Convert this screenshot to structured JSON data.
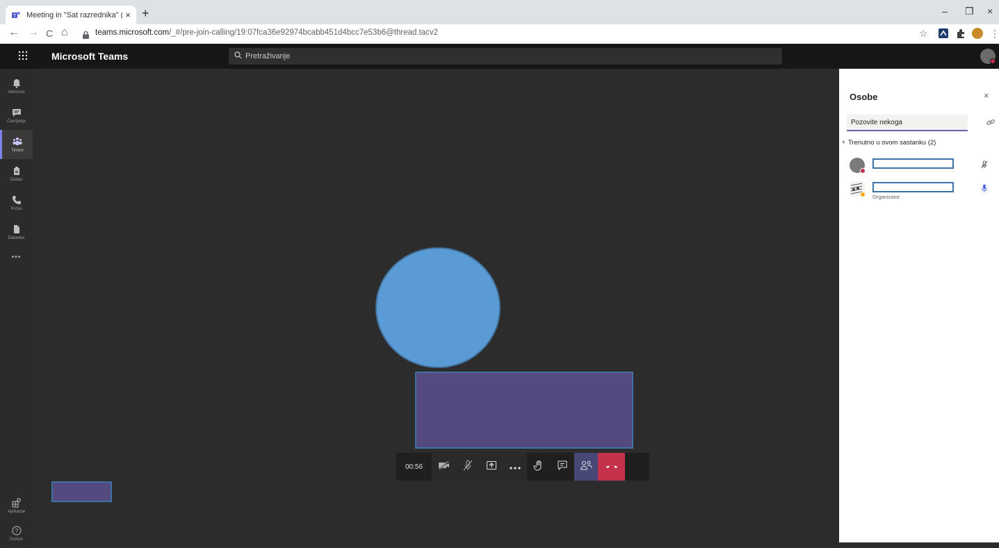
{
  "browser": {
    "tab_title": "Meeting in \"Sat razrednika\" (Sast",
    "tab_close": "×",
    "new_tab": "+",
    "url_domain": "teams.microsoft.com",
    "url_path": "/_#/pre-join-calling/19:07fca36e92974bcabb451d4bcc7e53b6@thread.tacv2",
    "minimize": "–",
    "restore": "❐",
    "close": "×",
    "back": "←",
    "forward": "→",
    "reload": "C",
    "home": "⌂",
    "star": "☆",
    "menu": "⋮"
  },
  "teams": {
    "app_name": "Microsoft Teams",
    "search_placeholder": "Pretraživanje",
    "waffle": "⋮⋮⋮"
  },
  "rail": {
    "items": [
      {
        "label": "Aktivnost",
        "icon": "bell-icon"
      },
      {
        "label": "Ćavrljanje",
        "icon": "chat-icon"
      },
      {
        "label": "Timovi",
        "icon": "teams-icon"
      },
      {
        "label": "Zadaci",
        "icon": "assignments-icon"
      },
      {
        "label": "Pozivi",
        "icon": "phone-icon"
      },
      {
        "label": "Datoteke",
        "icon": "files-icon"
      }
    ],
    "more": "•••",
    "apps_label": "Aplikacije",
    "help_label": "Pomoć"
  },
  "call": {
    "timer": "00:56"
  },
  "panel": {
    "title": "Osobe",
    "close": "×",
    "invite_placeholder": "Pozovite nekoga",
    "section_label": "Trenutno u ovom sastanku (2)",
    "participants": [
      {
        "role": "",
        "status_color": "#c4314b",
        "muted": true
      },
      {
        "role": "Organizator",
        "status_color": "#f8a800",
        "muted": false
      }
    ]
  },
  "colors": {
    "accent": "#6264a7",
    "hangup": "#c4314b",
    "avatar_circle": "#5b9bd5",
    "video_tile": "#554a7f"
  }
}
